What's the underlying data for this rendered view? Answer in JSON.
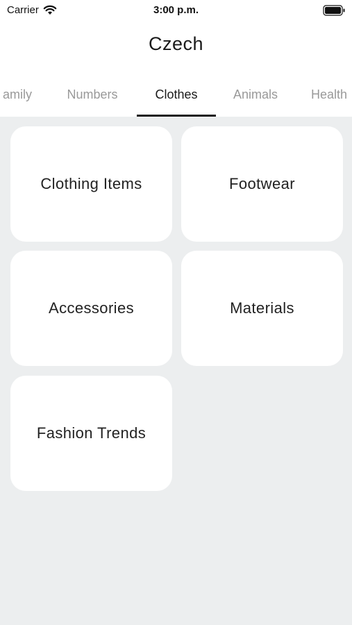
{
  "status_bar": {
    "carrier": "Carrier",
    "time": "3:00 p.m.",
    "wifi_icon": "wifi-icon",
    "battery_icon": "battery-icon"
  },
  "header": {
    "title": "Czech"
  },
  "tabs": {
    "items": [
      {
        "label": "amily",
        "active": false
      },
      {
        "label": "Numbers",
        "active": false
      },
      {
        "label": "Clothes",
        "active": true
      },
      {
        "label": "Animals",
        "active": false
      },
      {
        "label": "Health",
        "active": false
      }
    ]
  },
  "categories": {
    "items": [
      {
        "label": "Clothing Items"
      },
      {
        "label": "Footwear"
      },
      {
        "label": "Accessories"
      },
      {
        "label": "Materials"
      },
      {
        "label": "Fashion Trends"
      }
    ]
  },
  "colors": {
    "background": "#eceeef",
    "card": "#ffffff",
    "active_tab": "#1a1a1a",
    "inactive_tab": "#999999"
  }
}
